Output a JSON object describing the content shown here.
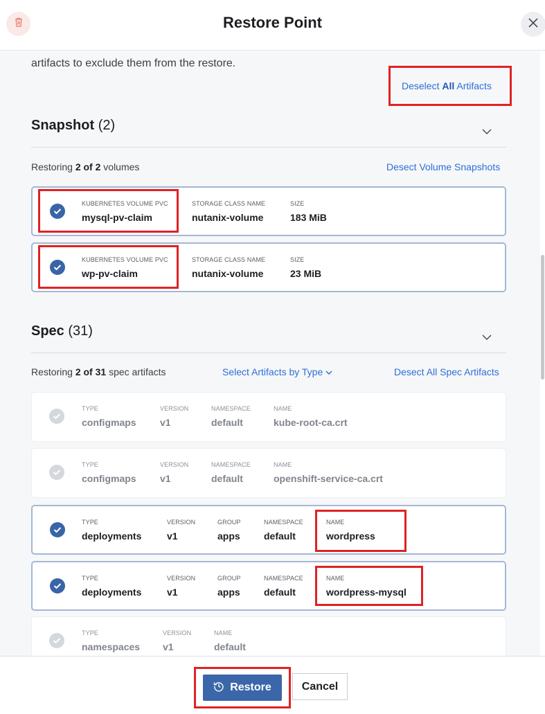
{
  "header": {
    "title": "Restore Point",
    "trash_icon": "trash-icon",
    "close_icon": "close-icon"
  },
  "intro": {
    "partial_text": "artifacts to exclude them from the restore.",
    "deselect_all_prefix": "Deselect",
    "deselect_all_bold": "All",
    "deselect_all_suffix": "Artifacts"
  },
  "snapshot": {
    "title": "Snapshot",
    "count": "(2)",
    "restoring_prefix": "Restoring",
    "restoring_bold": "2 of 2",
    "restoring_suffix": "volumes",
    "deselect_link": "Desect Volume Snapshots",
    "cards": [
      {
        "selected": true,
        "cols": [
          {
            "label": "KUBERNETES VOLUME PVC",
            "value": "mysql-pv-claim"
          },
          {
            "label": "STORAGE CLASS NAME",
            "value": "nutanix-volume"
          },
          {
            "label": "SIZE",
            "value": "183 MiB"
          }
        ]
      },
      {
        "selected": true,
        "cols": [
          {
            "label": "KUBERNETES VOLUME PVC",
            "value": "wp-pv-claim"
          },
          {
            "label": "STORAGE CLASS NAME",
            "value": "nutanix-volume"
          },
          {
            "label": "SIZE",
            "value": "23 MiB"
          }
        ]
      }
    ]
  },
  "spec": {
    "title": "Spec",
    "count": "(31)",
    "restoring_prefix": "Restoring",
    "restoring_bold": "2 of 31",
    "restoring_suffix": "spec artifacts",
    "select_by_type": "Select Artifacts by Type",
    "deselect_link": "Desect All Spec Artifacts",
    "cards": [
      {
        "selected": false,
        "cols": [
          {
            "label": "TYPE",
            "value": "configmaps"
          },
          {
            "label": "VERSION",
            "value": "v1"
          },
          {
            "label": "NAMESPACE",
            "value": "default"
          },
          {
            "label": "NAME",
            "value": "kube-root-ca.crt"
          }
        ]
      },
      {
        "selected": false,
        "cols": [
          {
            "label": "TYPE",
            "value": "configmaps"
          },
          {
            "label": "VERSION",
            "value": "v1"
          },
          {
            "label": "NAMESPACE",
            "value": "default"
          },
          {
            "label": "NAME",
            "value": "openshift-service-ca.crt"
          }
        ]
      },
      {
        "selected": true,
        "cols": [
          {
            "label": "TYPE",
            "value": "deployments"
          },
          {
            "label": "VERSION",
            "value": "v1"
          },
          {
            "label": "GROUP",
            "value": "apps"
          },
          {
            "label": "NAMESPACE",
            "value": "default"
          },
          {
            "label": "NAME",
            "value": "wordpress"
          }
        ]
      },
      {
        "selected": true,
        "cols": [
          {
            "label": "TYPE",
            "value": "deployments"
          },
          {
            "label": "VERSION",
            "value": "v1"
          },
          {
            "label": "GROUP",
            "value": "apps"
          },
          {
            "label": "NAMESPACE",
            "value": "default"
          },
          {
            "label": "NAME",
            "value": "wordpress-mysql"
          }
        ]
      },
      {
        "selected": false,
        "cols": [
          {
            "label": "TYPE",
            "value": "namespaces"
          },
          {
            "label": "VERSION",
            "value": "v1"
          },
          {
            "label": "NAME",
            "value": "default"
          }
        ]
      }
    ]
  },
  "footer": {
    "restore_label": "Restore",
    "restore_icon": "restore-icon",
    "cancel_label": "Cancel"
  },
  "colors": {
    "accent": "#3b67aa",
    "link": "#2b6fd6",
    "highlight": "#e02222"
  }
}
